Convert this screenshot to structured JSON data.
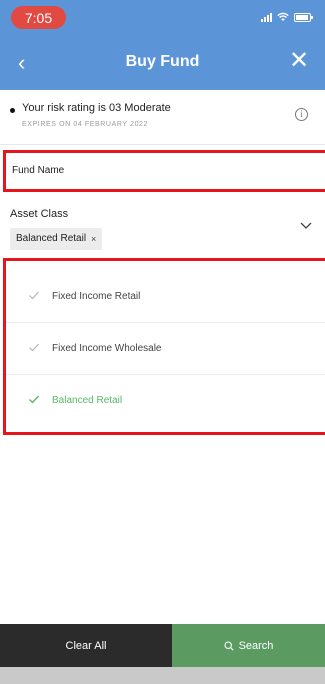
{
  "status_bar": {
    "time": "7:05"
  },
  "header": {
    "title": "Buy Fund",
    "back_glyph": "‹",
    "close_glyph": "✕"
  },
  "risk": {
    "text": "Your risk rating is 03 Moderate",
    "expiry": "EXPIRES ON 04 FEBRUARY 2022",
    "info_glyph": "i"
  },
  "fund_name": {
    "label": "Fund Name"
  },
  "asset_class": {
    "label": "Asset Class",
    "selected_tag": "Balanced Retail",
    "tag_remove_glyph": "×",
    "options": [
      {
        "label": "Fixed Income Retail",
        "selected": false
      },
      {
        "label": "Fixed Income Wholesale",
        "selected": false
      },
      {
        "label": "Balanced Retail",
        "selected": true
      }
    ]
  },
  "footer": {
    "clear_label": "Clear All",
    "search_label": "Search"
  },
  "colors": {
    "brand_blue": "#5b95d8",
    "accent_green": "#5b9b62",
    "selected_text": "#58b968",
    "highlight_red": "#e8141c",
    "dark_button": "#2b2b2b"
  },
  "icons": [
    "back-icon",
    "close-icon",
    "info-icon",
    "chevron-down-icon",
    "check-icon",
    "search-icon",
    "wifi-icon",
    "signal-icon",
    "battery-icon"
  ]
}
